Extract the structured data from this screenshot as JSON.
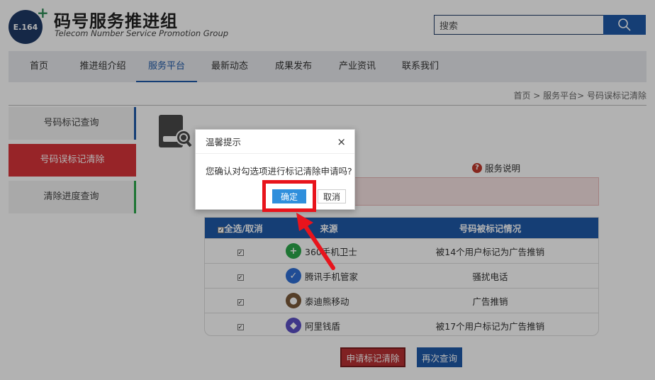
{
  "header": {
    "logo_text": "E.164",
    "title": "码号服务推进组",
    "subtitle": "Telecom Number Service  Promotion Group",
    "search_value": "搜索"
  },
  "nav": {
    "items": [
      {
        "label": "首页"
      },
      {
        "label": "推进组介绍"
      },
      {
        "label": "服务平台"
      },
      {
        "label": "最新动态"
      },
      {
        "label": "成果发布"
      },
      {
        "label": "产业资讯"
      },
      {
        "label": "联系我们"
      }
    ],
    "active": "服务平台"
  },
  "breadcrumb": "首页 > 服务平台> 号码误标记清除",
  "sidebar": {
    "items": [
      {
        "label": "号码标记查询"
      },
      {
        "label": "号码误标记清除"
      },
      {
        "label": "清除进度查询"
      }
    ]
  },
  "help": {
    "badge": "?",
    "label": "服务说明"
  },
  "table": {
    "headers": [
      "全选/取消",
      "来源",
      "号码被标记情况"
    ],
    "rows": [
      {
        "source": "360手机卫士",
        "status": "被14个用户标记为广告推销",
        "icon_color": "#2ca84b",
        "icon_glyph": "+"
      },
      {
        "source": "腾讯手机管家",
        "status": "骚扰电话",
        "icon_color": "#2f6fd6",
        "icon_glyph": "✓"
      },
      {
        "source": "泰迪熊移动",
        "status": "广告推销",
        "icon_color": "#7a5a3a",
        "icon_glyph": "●"
      },
      {
        "source": "阿里钱盾",
        "status": "被17个用户标记为广告推销",
        "icon_color": "#5b4fc4",
        "icon_glyph": "◆"
      }
    ]
  },
  "buttons": {
    "apply": "申请标记清除",
    "requery": "再次查询"
  },
  "dialog": {
    "title": "温馨提示",
    "close": "×",
    "message": "您确认对勾选项进行标记清除申请吗?",
    "ok": "确定",
    "cancel": "取消"
  },
  "colors": {
    "brand": "#1f5aa8",
    "danger": "#d9343a",
    "highlight": "#e8141c"
  }
}
